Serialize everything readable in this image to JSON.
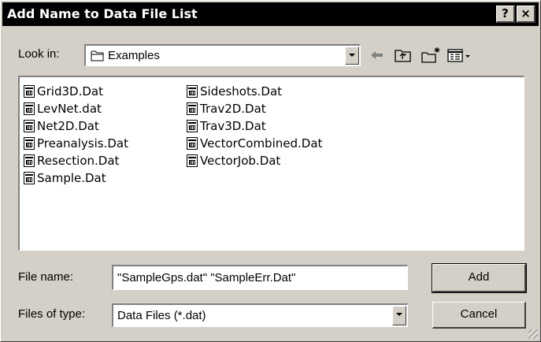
{
  "dialog": {
    "title": "Add Name to Data File List",
    "help_label": "?",
    "close_label": "×"
  },
  "look_in": {
    "label": "Look in:",
    "value": "Examples"
  },
  "files_col1": [
    "Grid3D.Dat",
    "LevNet.dat",
    "Net2D.Dat",
    "Preanalysis.Dat",
    "Resection.Dat",
    "Sample.Dat"
  ],
  "files_col2": [
    "Sideshots.Dat",
    "Trav2D.Dat",
    "Trav3D.Dat",
    "VectorCombined.Dat",
    "VectorJob.Dat"
  ],
  "file_name": {
    "label": "File name:",
    "value": "\"SampleGps.dat\" \"SampleErr.Dat\""
  },
  "file_type": {
    "label": "Files of type:",
    "value": "Data Files (*.dat)"
  },
  "buttons": {
    "add": "Add",
    "cancel": "Cancel"
  },
  "toolbar_icons": [
    "back-arrow-icon",
    "up-folder-icon",
    "new-folder-icon",
    "view-menu-icon"
  ]
}
